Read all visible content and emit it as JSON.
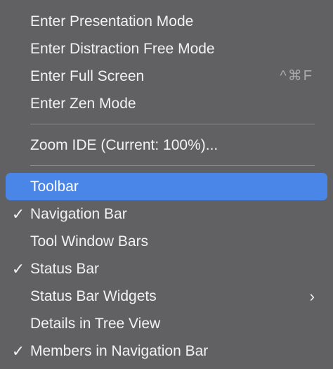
{
  "menu": {
    "group1": [
      {
        "label": "Enter Presentation Mode",
        "checked": false,
        "shortcut": ""
      },
      {
        "label": "Enter Distraction Free Mode",
        "checked": false,
        "shortcut": ""
      },
      {
        "label": "Enter Full Screen",
        "checked": false,
        "shortcut": "^⌘F"
      },
      {
        "label": "Enter Zen Mode",
        "checked": false,
        "shortcut": ""
      }
    ],
    "group2": [
      {
        "label": "Zoom IDE (Current: 100%)...",
        "checked": false
      }
    ],
    "group3": [
      {
        "label": "Toolbar",
        "checked": false,
        "selected": true
      },
      {
        "label": "Navigation Bar",
        "checked": true
      },
      {
        "label": "Tool Window Bars",
        "checked": false
      },
      {
        "label": "Status Bar",
        "checked": true
      },
      {
        "label": "Status Bar Widgets",
        "checked": false,
        "submenu": true
      },
      {
        "label": "Details in Tree View",
        "checked": false
      },
      {
        "label": "Members in Navigation Bar",
        "checked": true
      }
    ],
    "check_glyph": "✓",
    "submenu_glyph": "›",
    "colors": {
      "background": "#616163",
      "selection": "#4a86e8",
      "text": "#f2f2f2",
      "shortcut": "#a9a9ab"
    }
  }
}
